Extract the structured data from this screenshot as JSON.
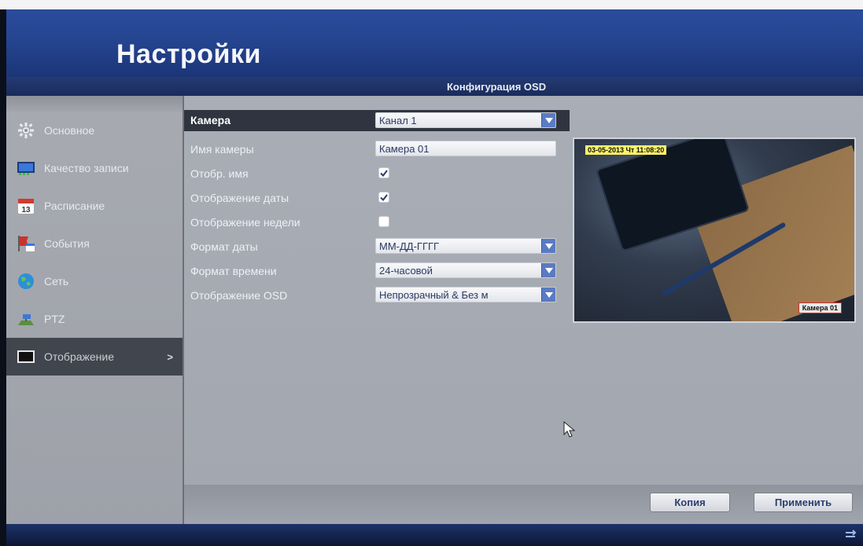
{
  "header": {
    "title": "Настройки"
  },
  "page": {
    "subtitle": "Конфигурация OSD"
  },
  "sidebar": {
    "items": [
      {
        "label": "Основное",
        "icon": "gear-icon"
      },
      {
        "label": "Качество записи",
        "icon": "record-quality-icon"
      },
      {
        "label": "Расписание",
        "icon": "calendar-icon"
      },
      {
        "label": "События",
        "icon": "event-flag-icon"
      },
      {
        "label": "Сеть",
        "icon": "globe-icon"
      },
      {
        "label": "PTZ",
        "icon": "ptz-camera-icon"
      },
      {
        "label": "Отображение",
        "icon": "monitor-icon",
        "active": true,
        "arrow": ">"
      }
    ]
  },
  "form": {
    "camera": {
      "label": "Камера",
      "value": "Канал 1"
    },
    "camera_name": {
      "label": "Имя камеры",
      "value": "Камера 01"
    },
    "show_name": {
      "label": "Отобр. имя",
      "checked": true
    },
    "show_date": {
      "label": "Отображение даты",
      "checked": true
    },
    "show_week": {
      "label": "Отображение недели",
      "checked": false
    },
    "date_format": {
      "label": "Формат даты",
      "value": "ММ-ДД-ГГГГ"
    },
    "time_format": {
      "label": "Формат времени",
      "value": "24-часовой"
    },
    "osd_mode": {
      "label": "Отображение OSD",
      "value": "Непрозрачный & Без м"
    }
  },
  "preview": {
    "osd_date_text": "03-05-2013 Чт 11:08:20",
    "osd_camera_text": "Камера 01"
  },
  "footer": {
    "copy_label": "Копия",
    "apply_label": "Применить"
  },
  "colors": {
    "accent": "#2b4b9d",
    "panel": "#a7aab1",
    "active_item": "#41464e",
    "dropdown_button": "#5a7bc4"
  }
}
